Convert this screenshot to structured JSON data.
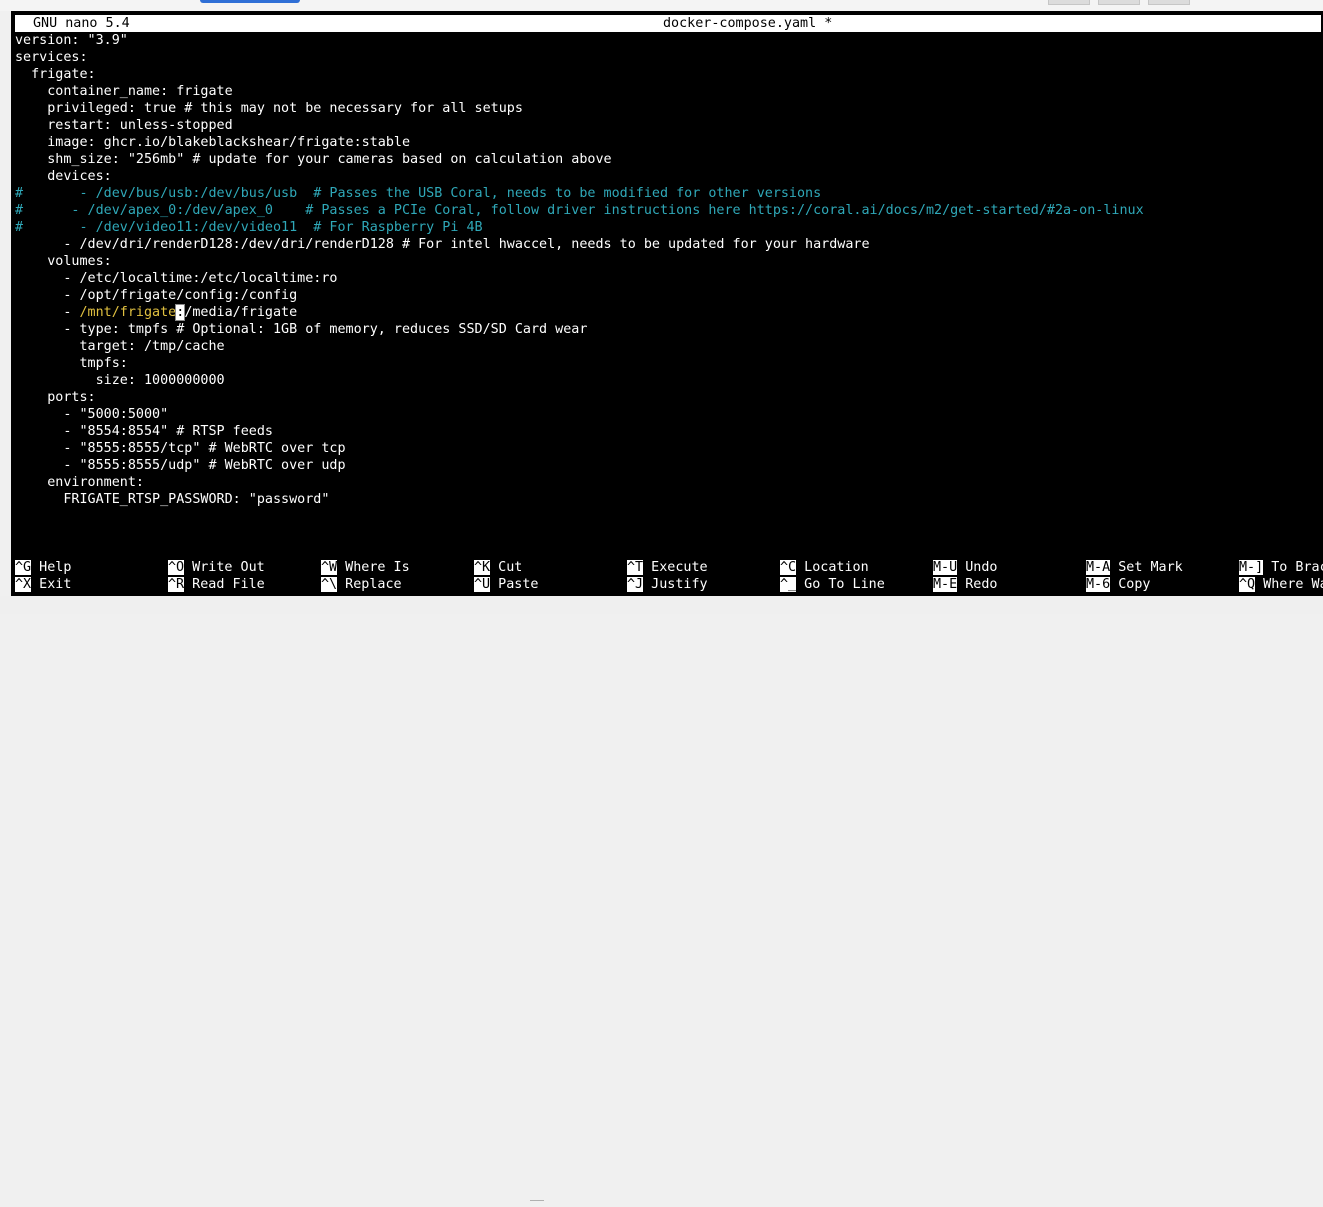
{
  "titlebar": {
    "app": "GNU nano 5.4",
    "file": "docker-compose.yaml *"
  },
  "editor": {
    "lines": [
      [
        {
          "t": "version: \"3.9\""
        }
      ],
      [
        {
          "t": "services:"
        }
      ],
      [
        {
          "t": "  frigate:"
        }
      ],
      [
        {
          "t": "    container_name: frigate"
        }
      ],
      [
        {
          "t": "    privileged: true # this may not be necessary for all setups"
        }
      ],
      [
        {
          "t": "    restart: unless-stopped"
        }
      ],
      [
        {
          "t": "    image: ghcr.io/blakeblackshear/frigate:stable"
        }
      ],
      [
        {
          "t": "    shm_size: \"256mb\" # update for your cameras based on calculation above"
        }
      ],
      [
        {
          "t": "    devices:"
        }
      ],
      [
        {
          "t": "#       - /dev/bus/usb:/dev/bus/usb  # Passes the USB Coral, needs to be modified for other versions",
          "c": "comment"
        }
      ],
      [
        {
          "t": "#      - /dev/apex_0:/dev/apex_0    # Passes a PCIe Coral, follow driver instructions here https://coral.ai/docs/m2/get-started/#2a-on-linux",
          "c": "comment"
        }
      ],
      [
        {
          "t": "#       - /dev/video11:/dev/video11  # For Raspberry Pi 4B",
          "c": "comment"
        }
      ],
      [
        {
          "t": "      - /dev/dri/renderD128:/dev/dri/renderD128 # For intel hwaccel, needs to be updated for your hardware"
        }
      ],
      [
        {
          "t": "    volumes:"
        }
      ],
      [
        {
          "t": "      - /etc/localtime:/etc/localtime:ro"
        }
      ],
      [
        {
          "t": "      - /opt/frigate/config:/config"
        }
      ],
      [
        {
          "t": "      - "
        },
        {
          "t": "/mnt/frigate",
          "c": "path"
        },
        {
          "t": ":",
          "c": "cursor"
        },
        {
          "t": "/media/frigate"
        }
      ],
      [
        {
          "t": "      - type: tmpfs # Optional: 1GB of memory, reduces SSD/SD Card wear"
        }
      ],
      [
        {
          "t": "        target: /tmp/cache"
        }
      ],
      [
        {
          "t": "        tmpfs:"
        }
      ],
      [
        {
          "t": "          size: 1000000000"
        }
      ],
      [
        {
          "t": "    ports:"
        }
      ],
      [
        {
          "t": "      - \"5000:5000\""
        }
      ],
      [
        {
          "t": "      - \"8554:8554\" # RTSP feeds"
        }
      ],
      [
        {
          "t": "      - \"8555:8555/tcp\" # WebRTC over tcp"
        }
      ],
      [
        {
          "t": "      - \"8555:8555/udp\" # WebRTC over udp"
        }
      ],
      [
        {
          "t": "    environment:"
        }
      ],
      [
        {
          "t": "      FRIGATE_RTSP_PASSWORD: \"password\""
        }
      ]
    ]
  },
  "shortcuts": {
    "row1": [
      {
        "key": "^G",
        "label": "Help"
      },
      {
        "key": "^O",
        "label": "Write Out"
      },
      {
        "key": "^W",
        "label": "Where Is"
      },
      {
        "key": "^K",
        "label": "Cut"
      },
      {
        "key": "^T",
        "label": "Execute"
      },
      {
        "key": "^C",
        "label": "Location"
      },
      {
        "key": "M-U",
        "label": "Undo"
      },
      {
        "key": "M-A",
        "label": "Set Mark"
      },
      {
        "key": "M-]",
        "label": "To Bracket"
      }
    ],
    "row2": [
      {
        "key": "^X",
        "label": "Exit"
      },
      {
        "key": "^R",
        "label": "Read File"
      },
      {
        "key": "^\\",
        "label": "Replace"
      },
      {
        "key": "^U",
        "label": "Paste"
      },
      {
        "key": "^J",
        "label": "Justify"
      },
      {
        "key": "^_",
        "label": "Go To Line"
      },
      {
        "key": "M-E",
        "label": "Redo"
      },
      {
        "key": "M-6",
        "label": "Copy"
      },
      {
        "key": "^Q",
        "label": "Where Was"
      }
    ]
  }
}
